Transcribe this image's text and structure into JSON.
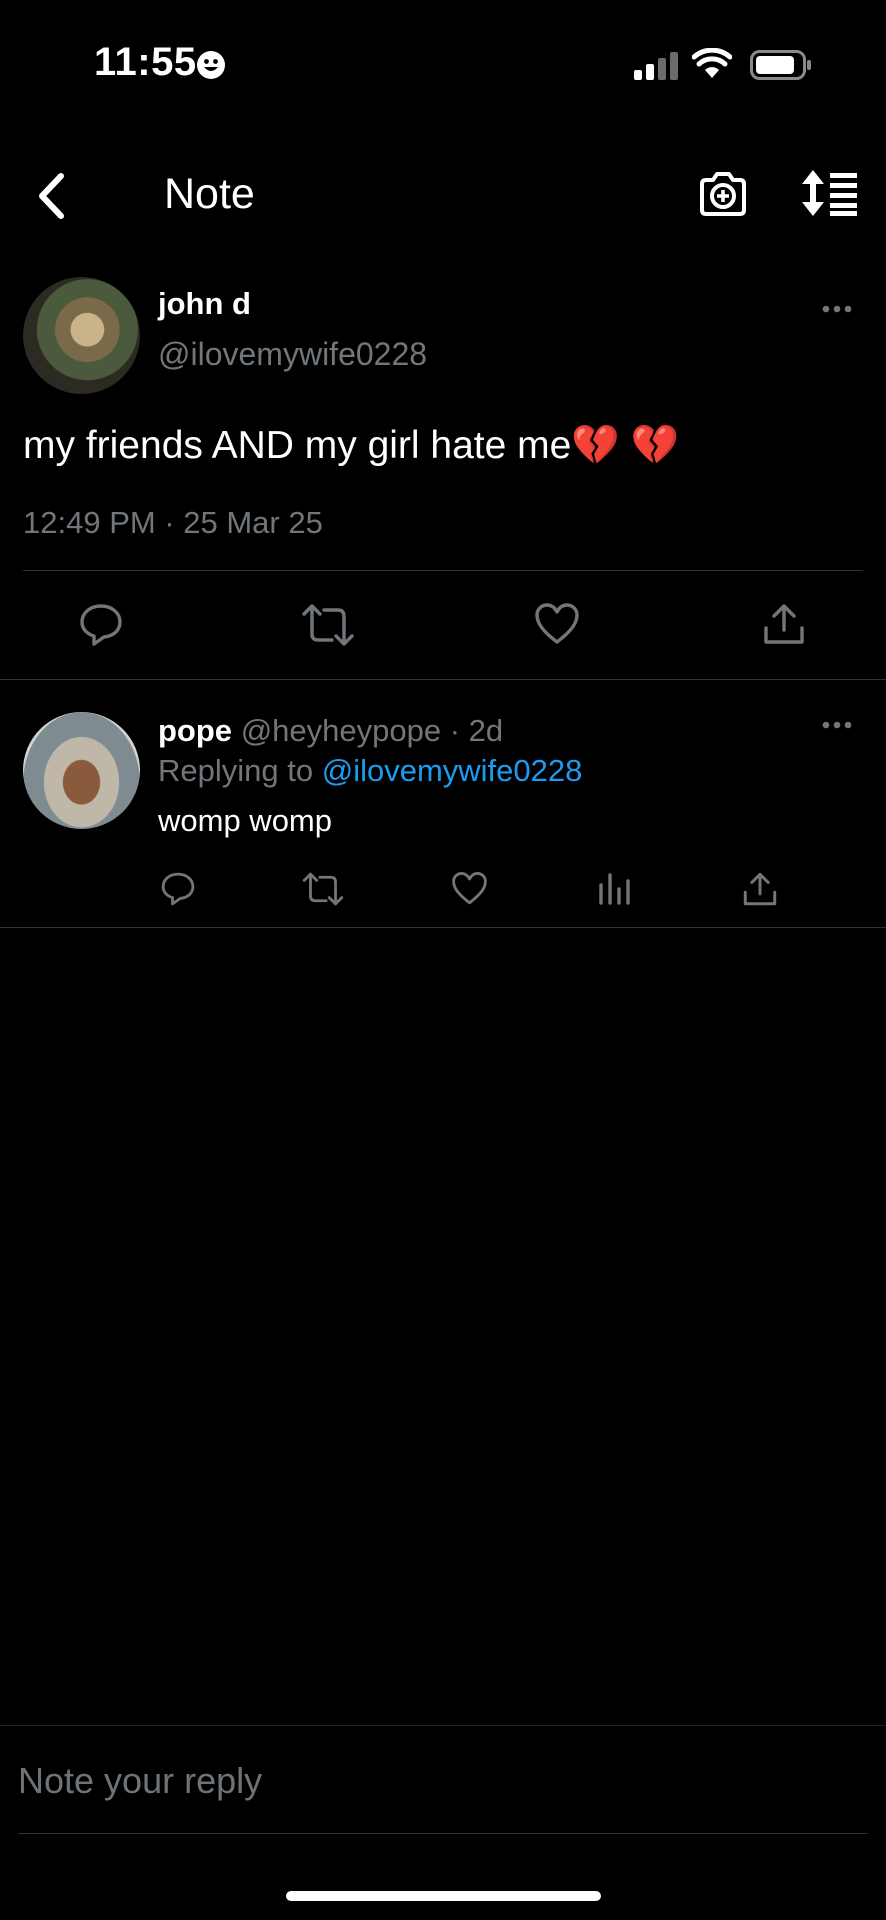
{
  "status_bar": {
    "time": "11:55",
    "icons": [
      "smiley-icon",
      "cellular-signal-icon",
      "wifi-icon",
      "battery-icon"
    ]
  },
  "nav": {
    "title": "Note",
    "icons": [
      "back-chevron-icon",
      "camera-add-icon",
      "sort-icon"
    ]
  },
  "main_post": {
    "name": "john d",
    "handle": "@ilovemywife0228",
    "text": "my friends AND my girl hate me💔 💔",
    "timestamp": "12:49 PM · 25 Mar 25",
    "actions": [
      "reply-icon",
      "repost-icon",
      "like-icon",
      "share-icon"
    ]
  },
  "reply_post": {
    "name": "pope",
    "meta": "@heyheypope · 2d",
    "replying_prefix": "Replying to",
    "replying_handle": "@ilovemywife0228",
    "text": "womp womp",
    "actions": [
      "reply-icon",
      "repost-icon",
      "like-icon",
      "views-icon",
      "share-icon"
    ]
  },
  "composer": {
    "placeholder": "Note your reply"
  },
  "colors": {
    "background": "#000000",
    "muted_text": "#71767b",
    "link": "#1d9bf0",
    "divider": "#2f3336"
  }
}
